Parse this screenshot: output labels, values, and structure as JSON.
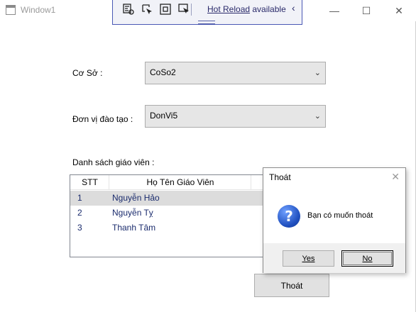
{
  "window": {
    "title": "Window1",
    "minimize_glyph": "—",
    "maximize_glyph": "☐",
    "close_glyph": "✕"
  },
  "dev_toolbar": {
    "hot_reload_link": "Hot Reload",
    "hot_reload_suffix": " available",
    "collapse_glyph": "‹",
    "icons": [
      "live-visual-tree-icon",
      "select-element-icon",
      "display-adorners-icon",
      "track-focus-icon"
    ]
  },
  "form": {
    "coso_label": "Cơ Sở :",
    "coso_value": "CoSo2",
    "donvi_label": "Đơn vị đào tạo :",
    "donvi_value": "DonVi5",
    "dropdown_glyph": "⌄",
    "list_label": "Danh sách giáo viên :",
    "exit_button": "Thoát"
  },
  "teachers": {
    "columns": [
      "STT",
      "Họ Tên Giáo Viên"
    ],
    "rows": [
      {
        "stt": "1",
        "name": "Nguyễn Hảo"
      },
      {
        "stt": "2",
        "name": "Nguyễn Tỵ"
      },
      {
        "stt": "3",
        "name": "Thanh Tâm"
      }
    ],
    "selected_row": 1
  },
  "dialog": {
    "title": "Thoát",
    "close_glyph": "✕",
    "icon_glyph": "?",
    "message": "Bạn có muốn thoát",
    "yes_label": "Yes",
    "no_label": "No"
  },
  "colors": {
    "toolbar_border": "#4a59b5",
    "list_text": "#1a2b6d",
    "selected_row": "#dcdcdc"
  }
}
